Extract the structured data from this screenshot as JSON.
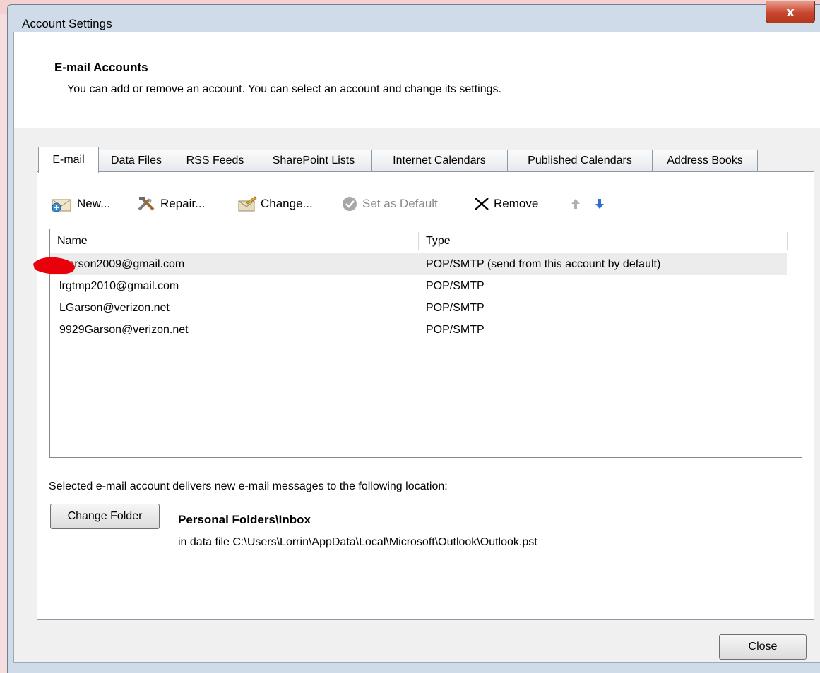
{
  "window": {
    "title": "Account Settings",
    "close_glyph": "x"
  },
  "header": {
    "title": "E-mail Accounts",
    "description": "You can add or remove an account. You can select an account and change its settings."
  },
  "tabs": [
    {
      "label": "E-mail",
      "active": true
    },
    {
      "label": "Data Files"
    },
    {
      "label": "RSS Feeds"
    },
    {
      "label": "SharePoint Lists"
    },
    {
      "label": "Internet Calendars"
    },
    {
      "label": "Published Calendars"
    },
    {
      "label": "Address Books"
    }
  ],
  "toolbar": {
    "new": "New...",
    "repair": "Repair...",
    "change": "Change...",
    "set_default": "Set as Default",
    "remove": "Remove"
  },
  "accounts_table": {
    "columns": [
      "Name",
      "Type"
    ],
    "rows": [
      {
        "name": "lgarson2009@gmail.com",
        "type": "POP/SMTP (send from this account by default)",
        "selected": true
      },
      {
        "name": "lrgtmp2010@gmail.com",
        "type": "POP/SMTP"
      },
      {
        "name": "LGarson@verizon.net",
        "type": "POP/SMTP"
      },
      {
        "name": "9929Garson@verizon.net",
        "type": "POP/SMTP"
      }
    ]
  },
  "delivery": {
    "text": "Selected e-mail account delivers new e-mail messages to the following location:",
    "change_folder_label": "Change Folder",
    "folder": "Personal Folders\\Inbox",
    "data_file": "in data file C:\\Users\\Lorrin\\AppData\\Local\\Microsoft\\Outlook\\Outlook.pst"
  },
  "footer": {
    "close_label": "Close"
  },
  "colors": {
    "annotation_mark": "#e8000b",
    "arrow_blue": "#2a6fd6"
  }
}
